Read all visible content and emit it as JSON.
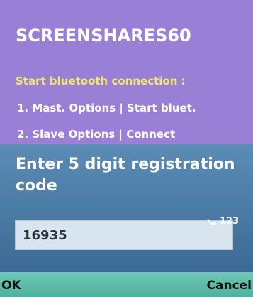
{
  "app": {
    "title": "SCREENSHARES60",
    "subtitle": "Start bluetooth connection :",
    "lines": [
      "1. Mast.  Options | Start bluet.",
      "2. Slave  Options | Connect"
    ]
  },
  "dialog": {
    "prompt": "Enter 5 digit registration code",
    "input_mode": {
      "icon": "pen-input-icon",
      "label": "123"
    },
    "field": {
      "value": "16935"
    }
  },
  "softkeys": {
    "left_label": "OK",
    "right_label": "Cancel"
  },
  "colors": {
    "app_background": "#9a7fd6",
    "subtitle": "#f2e86a",
    "dialog_background": "#4a7ba6",
    "field_background": "#d8e4ee",
    "softkey_bar": "#5fbda9"
  }
}
